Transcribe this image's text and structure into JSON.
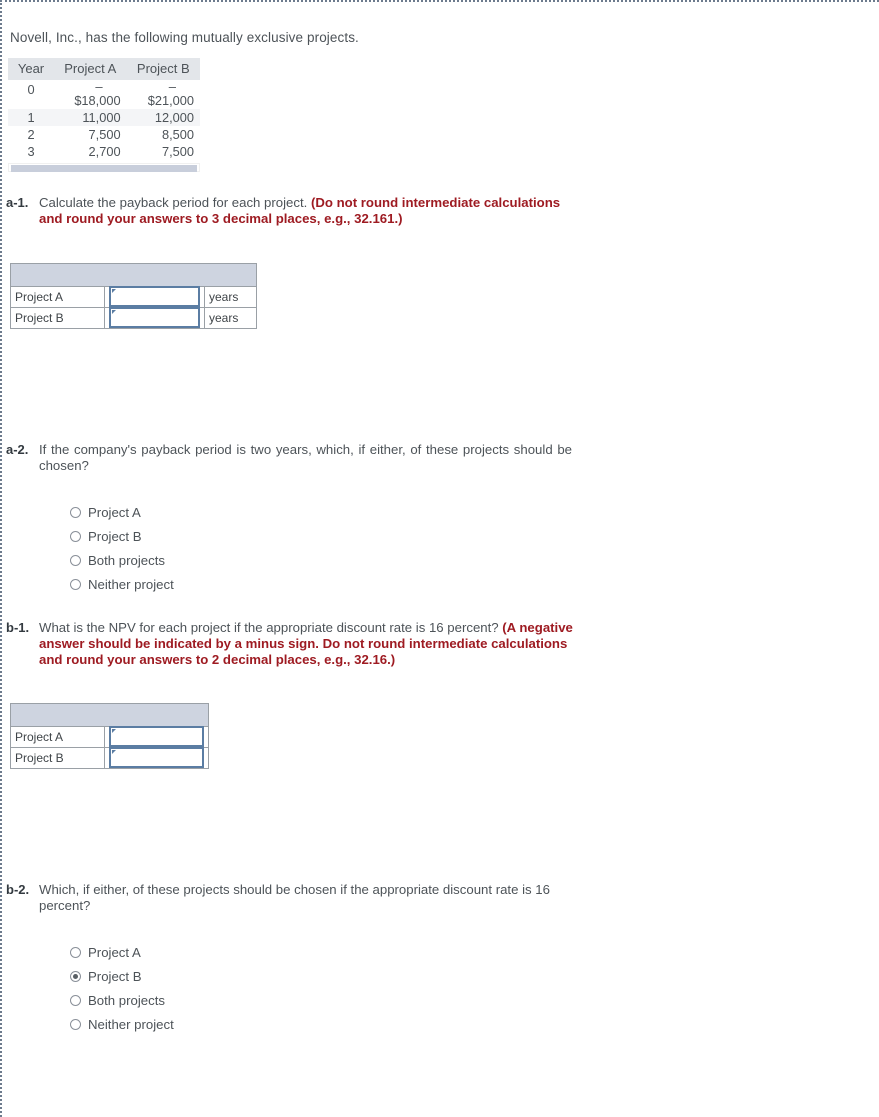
{
  "intro": "Novell, Inc., has the following mutually exclusive projects.",
  "cash_flow_table": {
    "columns": [
      "Year",
      "Project A",
      "Project B"
    ],
    "rows": [
      {
        "year": "0",
        "a_sign": "–",
        "b_sign": "–",
        "a": "$18,000",
        "b": "$21,000"
      },
      {
        "year": "1",
        "a_sign": "",
        "b_sign": "",
        "a": "11,000",
        "b": "12,000"
      },
      {
        "year": "2",
        "a_sign": "",
        "b_sign": "",
        "a": "7,500",
        "b": "8,500"
      },
      {
        "year": "3",
        "a_sign": "",
        "b_sign": "",
        "a": "2,700",
        "b": "7,500"
      }
    ]
  },
  "q_a1": {
    "tag": "a-1.",
    "text": "Calculate the payback period for each project. ",
    "emphasis": "(Do not round intermediate calculations and round your answers to 3 decimal places, e.g., 32.161.)",
    "table": {
      "rows": [
        {
          "label": "Project A",
          "value": "",
          "unit": "years"
        },
        {
          "label": "Project B",
          "value": "",
          "unit": "years"
        }
      ]
    }
  },
  "q_a2": {
    "tag": "a-2.",
    "text": "If the company's payback period is two years, which, if either, of these projects should be chosen?",
    "options": [
      {
        "label": "Project A",
        "selected": false
      },
      {
        "label": "Project B",
        "selected": false
      },
      {
        "label": "Both projects",
        "selected": false
      },
      {
        "label": "Neither project",
        "selected": false
      }
    ]
  },
  "q_b1": {
    "tag": "b-1.",
    "text": "What is the NPV for each project if the appropriate discount rate is 16 percent? ",
    "emphasis": "(A negative answer should be indicated by a minus sign. Do not round intermediate calculations and round your answers to 2 decimal places, e.g., 32.16.)",
    "table": {
      "rows": [
        {
          "label": "Project A",
          "value": ""
        },
        {
          "label": "Project B",
          "value": ""
        }
      ]
    }
  },
  "q_b2": {
    "tag": "b-2.",
    "text": "Which, if either, of these projects should be chosen if the appropriate discount rate is 16 percent?",
    "options": [
      {
        "label": "Project A",
        "selected": false
      },
      {
        "label": "Project B",
        "selected": true
      },
      {
        "label": "Both projects",
        "selected": false
      },
      {
        "label": "Neither project",
        "selected": false
      }
    ]
  },
  "colors": {
    "emphasis_red": "#9e1b22",
    "table_header_blue": "#ced4e0",
    "field_border_blue": "#5b7da3",
    "body_text": "#4d5358"
  }
}
